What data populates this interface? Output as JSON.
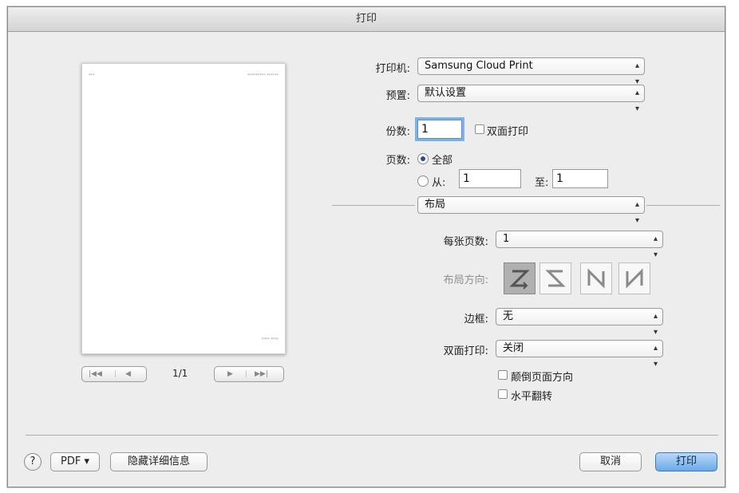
{
  "window": {
    "title": "打印"
  },
  "preview": {
    "header_left": "***",
    "header_right": "********* ******",
    "footer_right": "**** ****",
    "page_indicator": "1/1",
    "nav_first_label": "|◀◀",
    "nav_prev_label": "◀",
    "nav_next_label": "▶",
    "nav_last_label": "▶▶|"
  },
  "printer": {
    "label": "打印机:",
    "value": "Samsung Cloud Print"
  },
  "presets": {
    "label": "预置:",
    "value": "默认设置"
  },
  "copies": {
    "label": "份数:",
    "value": "1",
    "duplex_label": "双面打印",
    "duplex_checked": false
  },
  "pages": {
    "label": "页数:",
    "all_label": "全部",
    "all_selected": true,
    "from_label": "从:",
    "from_value": "1",
    "to_label": "至:",
    "to_value": "1"
  },
  "section": {
    "value": "布局"
  },
  "layout": {
    "pages_per_sheet_label": "每张页数:",
    "pages_per_sheet_value": "1",
    "direction_label": "布局方向:",
    "direction_icons": [
      "layout-z-icon",
      "layout-s-icon",
      "layout-n-icon",
      "layout-n-reverse-icon"
    ],
    "border_label": "边框:",
    "border_value": "无",
    "two_sided_label": "双面打印:",
    "two_sided_value": "关闭",
    "reverse_orientation_label": "颠倒页面方向",
    "flip_horizontal_label": "水平翻转"
  },
  "footer": {
    "help_label": "?",
    "pdf_label": "PDF ▾",
    "hide_details_label": "隐藏详细信息",
    "cancel_label": "取消",
    "print_label": "打印"
  },
  "colors": {
    "primary_button": "#6aa9ea",
    "focus_ring": "#7fb0e8"
  }
}
